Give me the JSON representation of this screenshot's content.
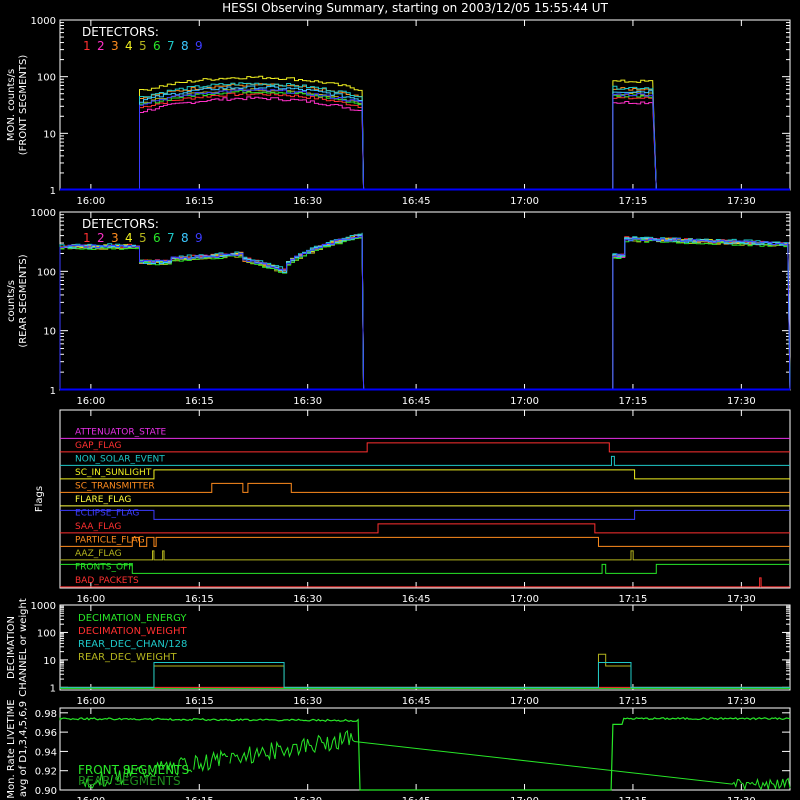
{
  "title": "HESSI Observing Summary, starting on 2003/12/05 15:55:44 UT",
  "time_ticks": [
    "16:00",
    "16:15",
    "16:30",
    "16:45",
    "17:00",
    "17:15",
    "17:30"
  ],
  "colors": {
    "det": [
      "#ff3030",
      "#ff30c8",
      "#ff8c1e",
      "#f0f020",
      "#b4b41e",
      "#28e628",
      "#1ec8c8",
      "#3cc8ff",
      "#3c3cff"
    ],
    "gap": "#ff3030",
    "night": "#0000ff",
    "white": "#ffffff",
    "magenta": "#e830e8"
  },
  "chart_data": [
    {
      "type": "line",
      "panel": "front",
      "ylabel": [
        "MON. counts/s",
        "(FRONT SEGMENTS)"
      ],
      "yscale": "log",
      "ylim": [
        1,
        1000
      ],
      "ytick_labels": [
        "1",
        "10",
        "100",
        "1000"
      ],
      "legend_title": "DETECTORS:",
      "legend_items": [
        "1",
        "2",
        "3",
        "4",
        "5",
        "6",
        "7",
        "8",
        "9"
      ],
      "x_unit": "minutes after 15:55:44",
      "day_intervals": [
        [
          11.0,
          42.0
        ],
        [
          76.5,
          82.5
        ]
      ],
      "series_levels": [
        38,
        32,
        55,
        75,
        45,
        42,
        58,
        50,
        44
      ]
    },
    {
      "type": "line",
      "panel": "rear",
      "ylabel": [
        "counts/s",
        "(REAR SEGMENTS)"
      ],
      "yscale": "log",
      "ylim": [
        1,
        1000
      ],
      "ytick_labels": [
        "1",
        "10",
        "100",
        "1000"
      ],
      "legend_title": "DETECTORS:",
      "legend_items": [
        "1",
        "2",
        "3",
        "4",
        "5",
        "6",
        "7",
        "8",
        "9"
      ],
      "day_intervals": [
        [
          0.0,
          42.0
        ],
        [
          76.5,
          101.0
        ]
      ],
      "series_levels": [
        270,
        260,
        255,
        265,
        250,
        245,
        275,
        260,
        265
      ]
    },
    {
      "type": "line",
      "panel": "flags",
      "ylabel": [
        "Flags"
      ],
      "flags": [
        {
          "label": "ATTENUATOR_STATE",
          "color": "#e830e8",
          "segments": [
            [
              0,
              0
            ]
          ]
        },
        {
          "label": "GAP_FLAG",
          "color": "#ff3030",
          "segments": [
            [
              0,
              0
            ],
            [
              42.5,
              1
            ],
            [
              76.0,
              0
            ]
          ]
        },
        {
          "label": "NON_SOLAR_EVENT",
          "color": "#1ec8c8",
          "segments": [
            [
              0,
              0
            ],
            [
              76.3,
              1
            ],
            [
              76.7,
              0
            ]
          ]
        },
        {
          "label": "SC_IN_SUNLIGHT",
          "color": "#f0f020",
          "segments": [
            [
              0,
              0
            ],
            [
              13.0,
              1
            ],
            [
              79.5,
              0
            ]
          ]
        },
        {
          "label": "SC_TRANSMITTER",
          "color": "#ff8c1e",
          "segments": [
            [
              0,
              0
            ],
            [
              21.0,
              1
            ],
            [
              25.3,
              0
            ],
            [
              26.0,
              1
            ],
            [
              32.0,
              0
            ]
          ]
        },
        {
          "label": "FLARE_FLAG",
          "color": "#ffff40",
          "segments": [
            [
              0,
              0
            ]
          ]
        },
        {
          "label": "ECLIPSE_FLAG",
          "color": "#3c3cff",
          "segments": [
            [
              0,
              1
            ],
            [
              13.0,
              0
            ],
            [
              79.5,
              1
            ]
          ]
        },
        {
          "label": "SAA_FLAG",
          "color": "#ff3030",
          "segments": [
            [
              0,
              0
            ],
            [
              44.0,
              1
            ],
            [
              74.0,
              0
            ]
          ]
        },
        {
          "label": "PARTICLE_FLAG",
          "color": "#ff8c1e",
          "segments": [
            [
              0,
              0
            ],
            [
              10.0,
              1
            ],
            [
              11.0,
              0
            ],
            [
              12.0,
              1
            ],
            [
              13.0,
              0
            ],
            [
              13.3,
              1
            ],
            [
              74.5,
              0
            ]
          ]
        },
        {
          "label": "AAZ_FLAG",
          "color": "#b4b41e",
          "segments": [
            [
              0,
              0
            ],
            [
              12.8,
              1
            ],
            [
              13.0,
              0
            ],
            [
              14.2,
              1
            ],
            [
              14.4,
              0
            ],
            [
              79.0,
              1
            ],
            [
              79.3,
              0
            ]
          ]
        },
        {
          "label": "FRONTS_OFF",
          "color": "#28e628",
          "segments": [
            [
              0,
              1
            ],
            [
              10.0,
              0
            ],
            [
              75.0,
              1
            ],
            [
              75.5,
              0
            ],
            [
              82.5,
              1
            ]
          ]
        },
        {
          "label": "BAD_PACKETS",
          "color": "#ff3030",
          "segments": [
            [
              0,
              0
            ],
            [
              96.8,
              1
            ],
            [
              97.0,
              0
            ]
          ]
        }
      ]
    },
    {
      "type": "line",
      "panel": "decimation",
      "ylabel": [
        "DECIMATION",
        "CHANNEL or weight"
      ],
      "yscale": "log",
      "ylim": [
        0.8,
        1000
      ],
      "ytick_labels": [
        "1",
        "10",
        "100",
        "1000"
      ],
      "legend": [
        {
          "label": "DECIMATION_ENERGY",
          "color": "#28e628"
        },
        {
          "label": "DECIMATION_WEIGHT",
          "color": "#ff3030"
        },
        {
          "label": "REAR_DEC_CHAN/128",
          "color": "#1ec8c8"
        },
        {
          "label": "REAR_DEC_WEIGHT",
          "color": "#b4b41e"
        }
      ],
      "rear_chan": [
        [
          0,
          1
        ],
        [
          13.0,
          8
        ],
        [
          31.0,
          1
        ],
        [
          74.5,
          8
        ],
        [
          79.0,
          1
        ]
      ],
      "rear_weight": [
        [
          0,
          1
        ],
        [
          13.0,
          6
        ],
        [
          31.0,
          1
        ],
        [
          74.5,
          16
        ],
        [
          75.5,
          6
        ],
        [
          79.0,
          1
        ]
      ]
    },
    {
      "type": "line",
      "panel": "livetime",
      "ylabel": [
        "Mon. Rate LIVETIME",
        "avg of D1,3,4,5,6,9"
      ],
      "ylim": [
        0.9,
        0.98
      ],
      "ytick_labels": [
        "0.90",
        "0.92",
        "0.94",
        "0.96",
        "0.98"
      ],
      "legend": [
        {
          "label": "FRONT SEGMENTS",
          "color": "#28e628"
        },
        {
          "label": "REAR SEGMENTS",
          "color": "#1e8c1e"
        }
      ],
      "front_level": 0.974
    }
  ]
}
